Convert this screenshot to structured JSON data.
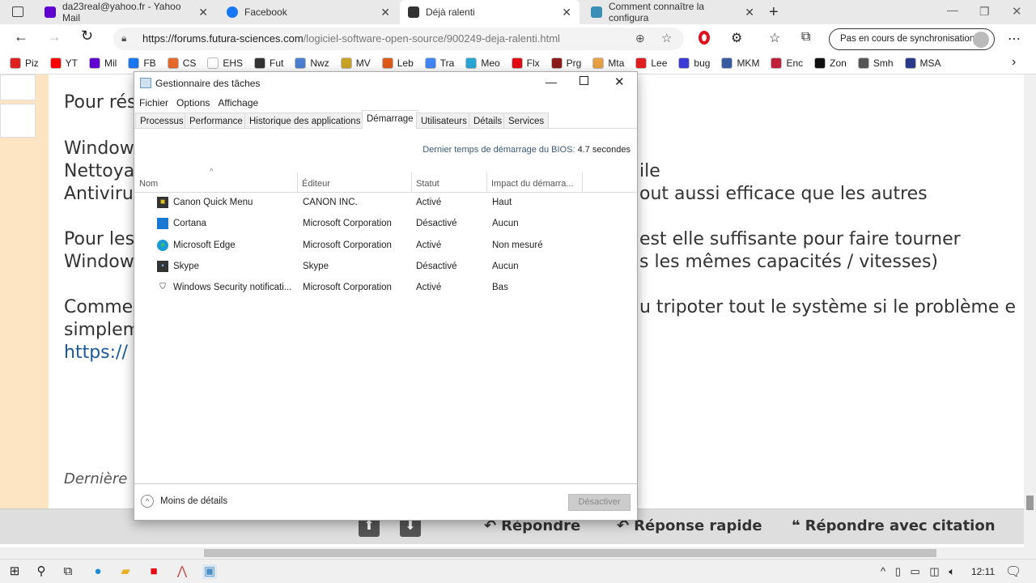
{
  "browser": {
    "tabs": [
      {
        "label": "da23real@yahoo.fr - Yahoo Mail",
        "icon": "yahoo-mail-icon",
        "color": "#6001d2"
      },
      {
        "label": "Facebook",
        "icon": "facebook-icon",
        "color": "#1877f2"
      },
      {
        "label": "Déjà ralenti",
        "icon": "futura-icon",
        "color": "#333333"
      },
      {
        "label": "Comment connaître la configura",
        "icon": "site-icon",
        "color": "#3a8fb7"
      }
    ],
    "url_domain": "https://forums.futura-sciences.com",
    "url_path": "/logiciel-software-open-source/900249-deja-ralenti.html",
    "sync_label": "Pas en cours de synchronisation",
    "bookmarks": [
      {
        "label": "Piz",
        "color": "#e02020"
      },
      {
        "label": "YT",
        "color": "#ff0000"
      },
      {
        "label": "Mil",
        "color": "#6001d2"
      },
      {
        "label": "FB",
        "color": "#1877f2"
      },
      {
        "label": "CS",
        "color": "#e86a2a"
      },
      {
        "label": "EHS",
        "color": "#ffffff"
      },
      {
        "label": "Fut",
        "color": "#333333"
      },
      {
        "label": "Nwz",
        "color": "#4a7fd4"
      },
      {
        "label": "MV",
        "color": "#c9a227"
      },
      {
        "label": "Leb",
        "color": "#e05a1a"
      },
      {
        "label": "Tra",
        "color": "#4285f4"
      },
      {
        "label": "Meo",
        "color": "#2aa6d6"
      },
      {
        "label": "Flx",
        "color": "#e50914"
      },
      {
        "label": "Prg",
        "color": "#8b1a1a"
      },
      {
        "label": "Mta",
        "color": "#e8a040"
      },
      {
        "label": "Lee",
        "color": "#e02020"
      },
      {
        "label": "bug",
        "color": "#3a3ad6"
      },
      {
        "label": "MKM",
        "color": "#3a5aa0"
      },
      {
        "label": "Enc",
        "color": "#c0203a"
      },
      {
        "label": "Zon",
        "color": "#111111"
      },
      {
        "label": "Smh",
        "color": "#555555"
      },
      {
        "label": "MSA",
        "color": "#2a3a8a"
      }
    ]
  },
  "forum": {
    "left_lines": [
      "Pour rés",
      "Window",
      "Nettoya",
      "Antiviru",
      "Pour les",
      "Window",
      "Comme",
      "simplem",
      "https://",
      "Dernière"
    ],
    "right_lines": [
      "ile",
      "out aussi efficace que les autres",
      "est elle suffisante pour faire tourner",
      "s les mêmes capacités / vitesses)",
      "u tripoter tout le système si le problème e"
    ],
    "buttons": {
      "reply": "Répondre",
      "quick_reply": "Réponse rapide",
      "quote_reply": "Répondre avec citation"
    }
  },
  "taskmanager": {
    "title": "Gestionnaire des tâches",
    "menu": [
      "Fichier",
      "Options",
      "Affichage"
    ],
    "tabs": [
      "Processus",
      "Performance",
      "Historique des applications",
      "Démarrage",
      "Utilisateurs",
      "Détails",
      "Services"
    ],
    "bios_label": "Dernier temps de démarrage du BIOS:",
    "bios_value": "4.7 secondes",
    "columns": [
      "Nom",
      "Éditeur",
      "Statut",
      "Impact du démarra..."
    ],
    "rows": [
      {
        "name": "Canon Quick Menu",
        "publisher": "CANON INC.",
        "status": "Activé",
        "impact": "Haut"
      },
      {
        "name": "Cortana",
        "publisher": "Microsoft Corporation",
        "status": "Désactivé",
        "impact": "Aucun"
      },
      {
        "name": "Microsoft Edge",
        "publisher": "Microsoft Corporation",
        "status": "Activé",
        "impact": "Non mesuré"
      },
      {
        "name": "Skype",
        "publisher": "Skype",
        "status": "Désactivé",
        "impact": "Aucun"
      },
      {
        "name": "Windows Security notificati...",
        "publisher": "Microsoft Corporation",
        "status": "Activé",
        "impact": "Bas"
      }
    ],
    "less_details": "Moins de détails",
    "disable_button": "Désactiver"
  },
  "taskbar": {
    "time": "12:11"
  }
}
